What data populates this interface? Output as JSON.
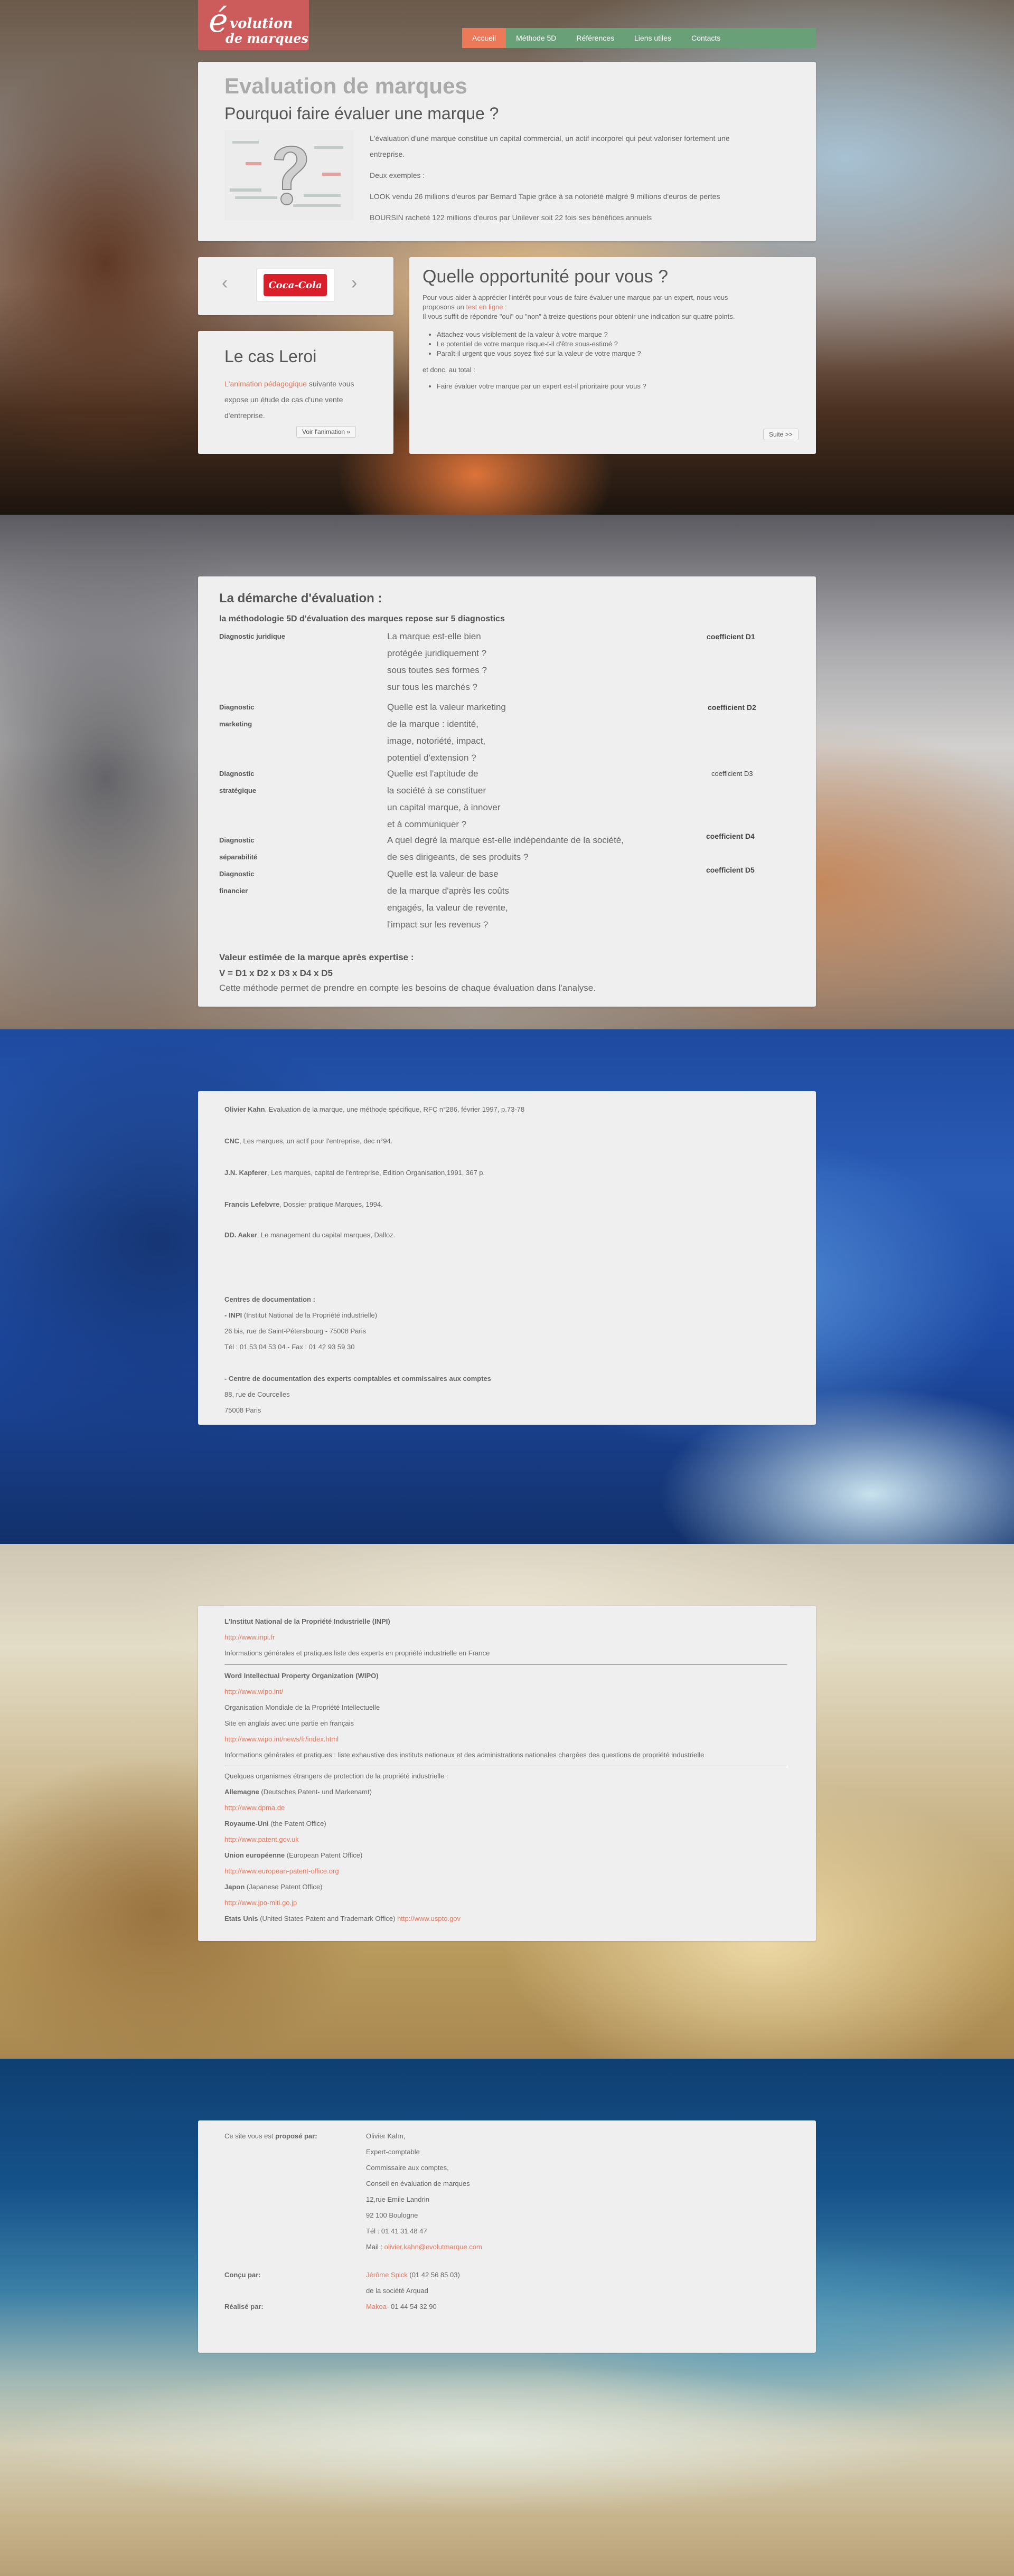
{
  "header": {
    "logo_initial": "é",
    "logo_line1": "volution",
    "logo_line2": "de marques",
    "nav": [
      "Accueil",
      "Méthode 5D",
      "Références",
      "Liens utiles",
      "Contacts"
    ]
  },
  "intro": {
    "title_faded": "Evaluation de marques",
    "title": "Pourquoi faire évaluer une marque ?",
    "lines": [
      "L'évaluation d'une marque constitue un capital commercial, un actif incorporel qui peut valoriser fortement une",
      "entreprise.",
      "Deux exemples :",
      "LOOK vendu 26 millions d'euros par Bernard Tapie grâce à sa notoriété malgré 9 millions d'euros de pertes",
      "BOURSIN racheté 122 millions d'euros par Unilever soit 22 fois ses bénéfices annuels"
    ]
  },
  "carousel": {
    "prev": "‹",
    "next": "›",
    "logo_text": "Coca-Cola"
  },
  "leroi": {
    "title": "Le cas Leroi",
    "link": "L'animation pédagogique",
    "text1": " suivante vous",
    "text2": "expose un étude de cas d'une vente",
    "text3": "d'entreprise.",
    "button": "Voir l'animation »"
  },
  "opportunity": {
    "title": "Quelle opportunité pour vous ?",
    "p1": "Pour vous aider à apprécier l'intérêt pour vous de faire évaluer une marque par un expert, nous vous",
    "p2a": "proposons un ",
    "p2link": "test en ligne :",
    "p3": "Il vous suffit de répondre \"oui\" ou \"non\" à treize questions pour obtenir une indication sur quatre points.",
    "bullets": [
      "Attachez-vous visiblement de la valeur à votre marque ?",
      "Le potentiel de votre marque risque-t-il d'être sous-estimé ?",
      "Paraît-il urgent que vous soyez fixé sur la valeur de votre marque ?"
    ],
    "total_label": "et donc, au total :",
    "total_bullet": "Faire évaluer votre marque par un expert est-il prioritaire pour vous ?",
    "button": "Suite >>"
  },
  "demarche": {
    "title": "La démarche d'évaluation :",
    "subtitle": "la méthodologie 5D d'évaluation des marques repose sur 5 diagnostics",
    "rows": [
      {
        "label": [
          "Diagnostic juridique"
        ],
        "q": [
          "La marque est-elle bien",
          "protégée juridiquement ?",
          "sous toutes ses formes ?",
          "sur tous les marchés ?"
        ],
        "coef": "coefficient  D1"
      },
      {
        "label": [
          "Diagnostic",
          "marketing"
        ],
        "q": [
          "Quelle est la valeur marketing",
          "de la marque : identité,",
          "image, notoriété, impact,",
          "potentiel d'extension ?"
        ],
        "coef": "coefficient  D2"
      },
      {
        "label": [
          "Diagnostic",
          "stratégique"
        ],
        "q": [
          "Quelle est l'aptitude de",
          "la société à se constituer",
          "un capital marque, à innover",
          "et à communiquer ?"
        ],
        "coef": "coefficient D3"
      },
      {
        "label": [
          "Diagnostic",
          "séparabilité"
        ],
        "q": [
          "A quel degré la marque est-elle indépendante de la société,",
          "de ses dirigeants, de ses produits ?"
        ],
        "coef": "coefficient  D4"
      },
      {
        "label": [
          "Diagnostic",
          "financier"
        ],
        "q": [
          "Quelle est la valeur de base",
          "de la marque d'après les coûts",
          "engagés, la valeur de revente,",
          "l'impact sur les revenus ?"
        ],
        "coef": "coefficient  D5"
      }
    ],
    "result_title": "Valeur estimée de la marque après expertise :",
    "formula": "V = D1 x D2 x D3 x D4 x D5",
    "note": "Cette méthode permet de prendre en compte les besoins de chaque évaluation dans l'analyse."
  },
  "references": {
    "biblio": [
      {
        "bold": "Olivier Kahn",
        "rest": ", Evaluation de la marque, une méthode spécifique, RFC n°286, février 1997, p.73-78"
      },
      {
        "bold": "CNC",
        "rest": ", Les marques, un actif pour l'entreprise, dec n°94."
      },
      {
        "bold": "J.N. Kapferer",
        "rest": ", Les marques, capital de l'entreprise, Edition Organisation,1991, 367 p."
      },
      {
        "bold": "Francis Lefebvre",
        "rest": ", Dossier pratique Marques, 1994."
      },
      {
        "bold": "DD. Aaker",
        "rest": ", Le management du capital marques, Dalloz."
      }
    ],
    "centres_title": "Centres de documentation :",
    "inpi_bold": "- INPI",
    "inpi_rest": " (Institut National de la Propriété industrielle)",
    "inpi_addr": "26 bis, rue de Saint-Pétersbourg - 75008 Paris",
    "inpi_tel": "Tél : 01 53 04 53 04 - Fax : 01 42 93 59 30",
    "ec_title": "- Centre de documentation des experts comptables et commissaires aux comptes",
    "ec_addr1": "88, rue de Courcelles",
    "ec_addr2": "75008 Paris"
  },
  "liens": {
    "inpi_title": "L'Institut National de la Propriété Industrielle (INPI)",
    "inpi_url": "http://www.inpi.fr",
    "inpi_desc": "Informations générales et pratiques liste des experts en propriété industrielle en France",
    "wipo_title": "Word Intellectual Property Organization (WIPO)",
    "wipo_url": "http://www.wipo.int/",
    "wipo_desc1": "Organisation Mondiale de la Propriété Intellectuelle",
    "wipo_desc2": "Site en anglais avec une partie en français",
    "wipo_url2": "http://www.wipo.int/news/fr/index.html",
    "wipo_desc3": "Informations générales et pratiques : liste exhaustive des instituts nationaux et des administrations nationales chargées des questions de propriété industrielle",
    "foreign_title": "Quelques organismes étrangers de protection de la propriété industrielle :",
    "de_bold": "Allemagne",
    "de_rest": " (Deutsches Patent- und Markenamt)",
    "de_url": "http://www.dpma.de",
    "uk_bold": "Royaume-Uni",
    "uk_rest": " (the Patent Office)",
    "uk_url": "http://www.patent.gov.uk",
    "eu_bold": "Union européenne",
    "eu_rest": " (European Patent Office)",
    "eu_url": "http://www.european-patent-office.org",
    "jp_bold": "Japon",
    "jp_rest": " (Japanese Patent Office)",
    "jp_url": "http://www.jpo-miti.go.jp",
    "us_bold": "Etats Unis",
    "us_rest": " (United States Patent and Trademark Office) ",
    "us_url": "http://www.uspto.gov"
  },
  "contacts": {
    "proposed_label_a": "Ce site vous est ",
    "proposed_label_b": "proposé par:",
    "proposed": [
      "Olivier Kahn,",
      "Expert-comptable",
      "Commissaire aux comptes,",
      "Conseil en évaluation de marques",
      "12,rue Emile Landrin",
      "92 100 Boulogne",
      "Tél : 01 41 31 48 47"
    ],
    "mail_label": "Mail : ",
    "mail": "olivier.kahn@evolutmarque.com",
    "concu_label": "Conçu par:",
    "concu_link": "Jérôme Spick",
    "concu_rest": " (01 42 56 85 03)",
    "concu_line2": "de la société Arquad",
    "realise_label": "Réalisé par:",
    "realise_link": "Makoa",
    "realise_rest": "- 01 44 54 32 90"
  }
}
